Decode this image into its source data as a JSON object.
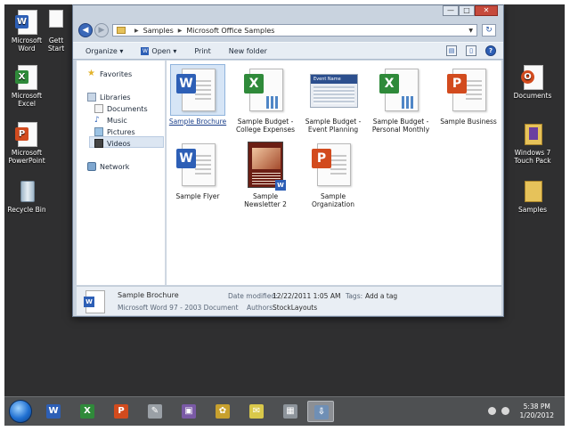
{
  "desktop": {
    "icons": [
      {
        "label": "Microsoft Word",
        "badge": "W"
      },
      {
        "label": "Gett Start",
        "badge": ""
      },
      {
        "label": "Microsoft Excel",
        "badge": "X"
      },
      {
        "label": "Microsoft PowerPoint",
        "badge": "P"
      },
      {
        "label": "Recycle Bin",
        "badge": ""
      },
      {
        "label": "Documents",
        "badge": "O"
      },
      {
        "label": "Windows 7 Touch Pack",
        "badge": ""
      },
      {
        "label": "Samples",
        "badge": ""
      }
    ]
  },
  "window": {
    "controls": {
      "minimize": "—",
      "maximize": "□",
      "close": "✕"
    },
    "breadcrumb": [
      "Samples",
      "Microsoft Office Samples"
    ],
    "toolbar": {
      "organize": "Organize ▾",
      "open": "Open ▾",
      "print": "Print",
      "new_folder": "New folder"
    },
    "nav": {
      "favorites": "Favorites",
      "libraries": "Libraries",
      "documents": "Documents",
      "music": "Music",
      "pictures": "Pictures",
      "videos": "Videos",
      "network": "Network"
    },
    "files": [
      {
        "name": "Sample Brochure",
        "type": "word",
        "badge": "W"
      },
      {
        "name": "Sample Budget - College Expenses",
        "type": "excel",
        "badge": "X"
      },
      {
        "name": "Sample Budget - Event Planning",
        "type": "event",
        "badge": ""
      },
      {
        "name": "Sample Budget - Personal Monthly",
        "type": "excel",
        "badge": "X"
      },
      {
        "name": "Sample Business",
        "type": "ppt",
        "badge": "P"
      },
      {
        "name": "Sample Flyer",
        "type": "word",
        "badge": "W"
      },
      {
        "name": "Sample Newsletter 2",
        "type": "news",
        "badge": "W"
      },
      {
        "name": "Sample Organization",
        "type": "ppt",
        "badge": "P"
      }
    ],
    "event_thumb_title": "Event Name",
    "details": {
      "name": "Sample Brochure",
      "type": "Microsoft Word 97 - 2003 Document",
      "date_label": "Date modified:",
      "date_value": "12/22/2011 1:05 AM",
      "authors_label": "Authors:",
      "authors_value": "StockLayouts",
      "tags_label": "Tags:",
      "tags_value": "Add a tag"
    }
  },
  "taskbar": {
    "apps": [
      "W",
      "X",
      "P",
      "✎",
      "▣",
      "✿",
      "✉",
      "▦",
      "⇩"
    ],
    "time": "5:38 PM",
    "date": "1/20/2012"
  },
  "colors": {
    "word": "#2d5fb6",
    "excel": "#2f8a3a",
    "powerpoint": "#d24b1e"
  }
}
